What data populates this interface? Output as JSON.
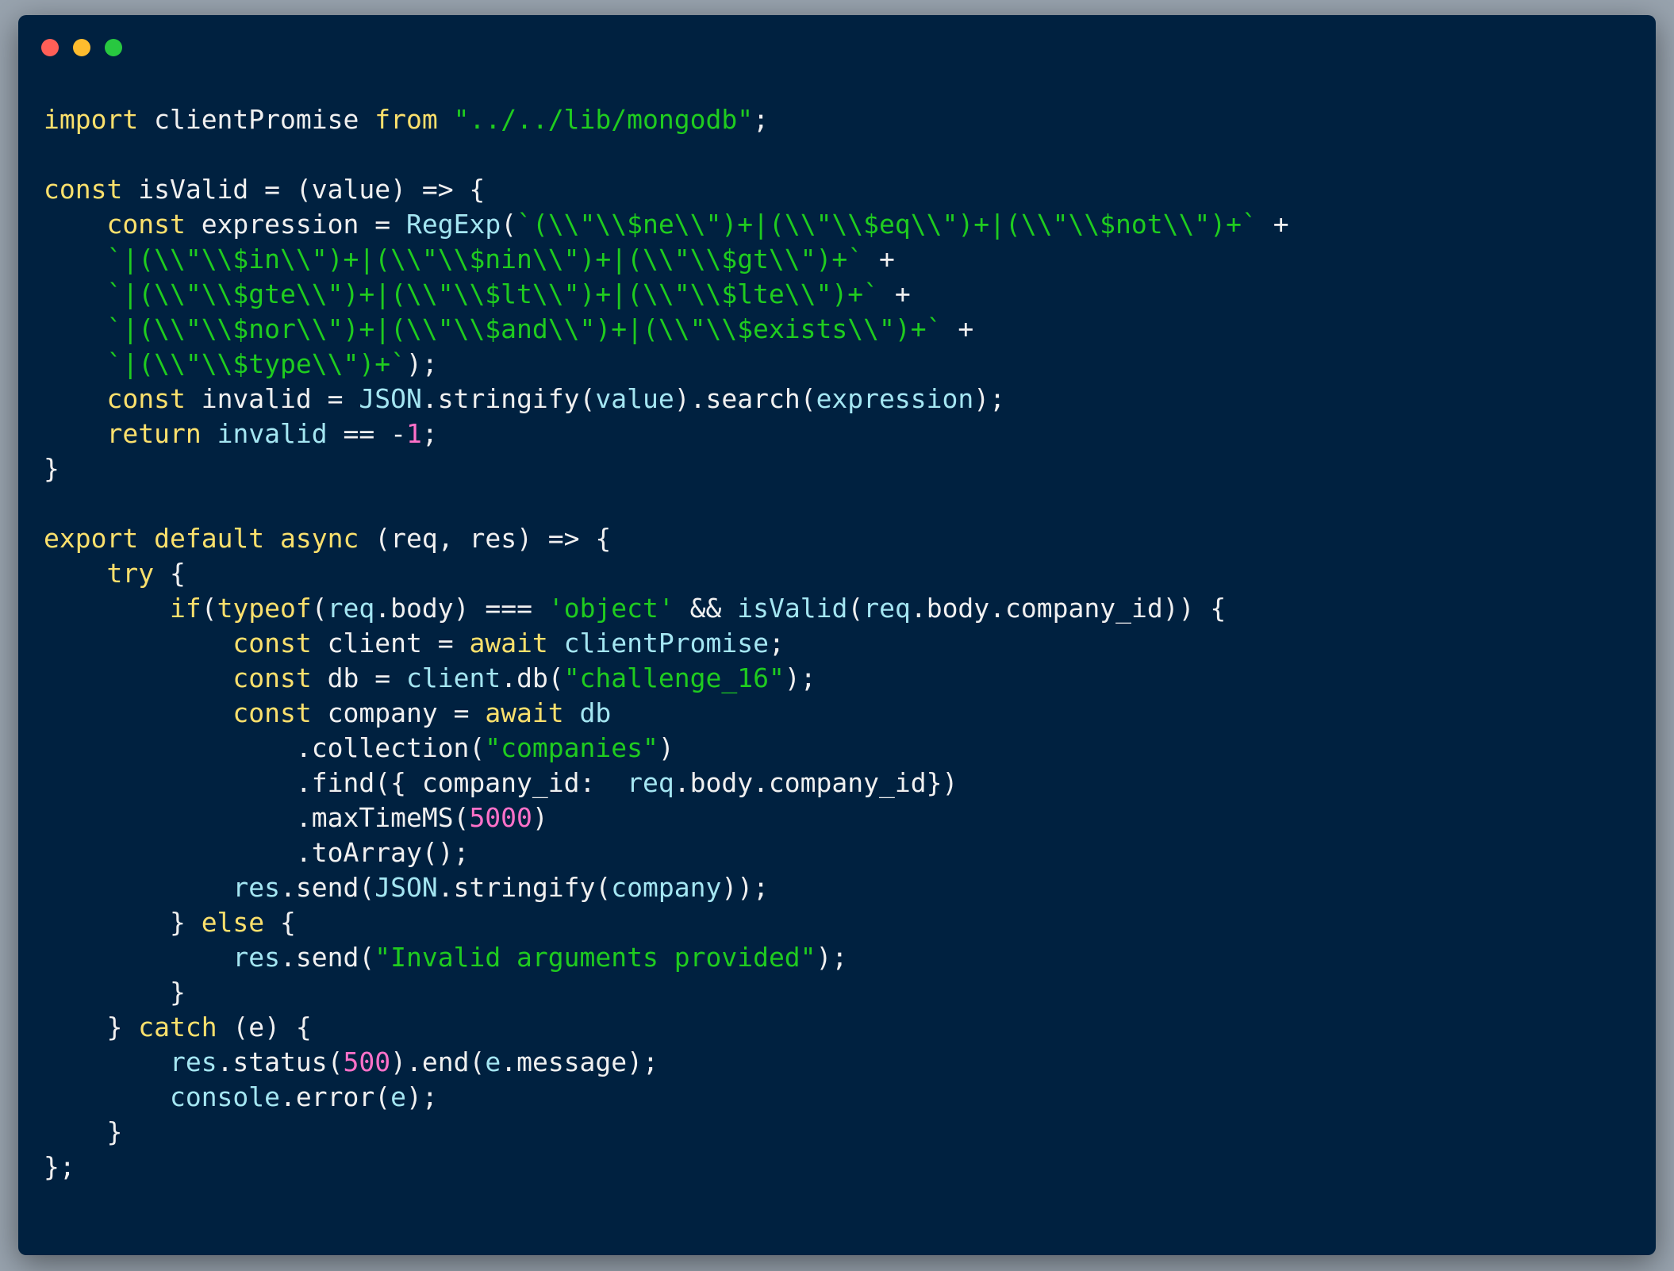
{
  "window": {
    "buttons": [
      {
        "name": "close",
        "color": "#ff5f57"
      },
      {
        "name": "minimize",
        "color": "#febc2e"
      },
      {
        "name": "maximize",
        "color": "#28c840"
      }
    ]
  },
  "colors": {
    "background": "#98a3ae",
    "editor_bg": "#002140",
    "keyword": "#fbe06c",
    "string": "#1fcc1f",
    "number": "#ff71c9",
    "identifier": "#a4e6f2",
    "plain": "#f0f0f0"
  },
  "code": {
    "language": "javascript",
    "lines": [
      [
        [
          "kw",
          "import"
        ],
        [
          "plain",
          " clientPromise "
        ],
        [
          "kw",
          "from"
        ],
        [
          "plain",
          " "
        ],
        [
          "str",
          "\"../../lib/mongodb\""
        ],
        [
          "plain",
          ";"
        ]
      ],
      [],
      [
        [
          "kw",
          "const"
        ],
        [
          "plain",
          " isValid = (value) => {"
        ]
      ],
      [
        [
          "plain",
          "    "
        ],
        [
          "kw",
          "const"
        ],
        [
          "plain",
          " expression = "
        ],
        [
          "id",
          "RegExp"
        ],
        [
          "plain",
          "("
        ],
        [
          "str",
          "`(\\\\\"\\\\$ne\\\\\")+|(\\\\\"\\\\$eq\\\\\")+|(\\\\\"\\\\$not\\\\\")+`"
        ],
        [
          "plain",
          " +"
        ]
      ],
      [
        [
          "plain",
          "    "
        ],
        [
          "str",
          "`|(\\\\\"\\\\$in\\\\\")+|(\\\\\"\\\\$nin\\\\\")+|(\\\\\"\\\\$gt\\\\\")+`"
        ],
        [
          "plain",
          " +"
        ]
      ],
      [
        [
          "plain",
          "    "
        ],
        [
          "str",
          "`|(\\\\\"\\\\$gte\\\\\")+|(\\\\\"\\\\$lt\\\\\")+|(\\\\\"\\\\$lte\\\\\")+`"
        ],
        [
          "plain",
          " +"
        ]
      ],
      [
        [
          "plain",
          "    "
        ],
        [
          "str",
          "`|(\\\\\"\\\\$nor\\\\\")+|(\\\\\"\\\\$and\\\\\")+|(\\\\\"\\\\$exists\\\\\")+`"
        ],
        [
          "plain",
          " +"
        ]
      ],
      [
        [
          "plain",
          "    "
        ],
        [
          "str",
          "`|(\\\\\"\\\\$type\\\\\")+`"
        ],
        [
          "plain",
          ");"
        ]
      ],
      [
        [
          "plain",
          "    "
        ],
        [
          "kw",
          "const"
        ],
        [
          "plain",
          " invalid = "
        ],
        [
          "id",
          "JSON"
        ],
        [
          "plain",
          ".stringify("
        ],
        [
          "id",
          "value"
        ],
        [
          "plain",
          ").search("
        ],
        [
          "id",
          "expression"
        ],
        [
          "plain",
          ");"
        ]
      ],
      [
        [
          "plain",
          "    "
        ],
        [
          "kw",
          "return"
        ],
        [
          "plain",
          " "
        ],
        [
          "id",
          "invalid"
        ],
        [
          "plain",
          " == -"
        ],
        [
          "num",
          "1"
        ],
        [
          "plain",
          ";"
        ]
      ],
      [
        [
          "plain",
          "}"
        ]
      ],
      [],
      [
        [
          "kw",
          "export"
        ],
        [
          "plain",
          " "
        ],
        [
          "kw",
          "default"
        ],
        [
          "plain",
          " "
        ],
        [
          "kw",
          "async"
        ],
        [
          "plain",
          " (req, res) => {"
        ]
      ],
      [
        [
          "plain",
          "    "
        ],
        [
          "kw",
          "try"
        ],
        [
          "plain",
          " {"
        ]
      ],
      [
        [
          "plain",
          "        "
        ],
        [
          "kw",
          "if"
        ],
        [
          "plain",
          "("
        ],
        [
          "kw",
          "typeof"
        ],
        [
          "plain",
          "("
        ],
        [
          "id",
          "req"
        ],
        [
          "plain",
          ".body) === "
        ],
        [
          "str",
          "'object'"
        ],
        [
          "plain",
          " && "
        ],
        [
          "id",
          "isValid"
        ],
        [
          "plain",
          "("
        ],
        [
          "id",
          "req"
        ],
        [
          "plain",
          ".body.company_id)) {"
        ]
      ],
      [
        [
          "plain",
          "            "
        ],
        [
          "kw",
          "const"
        ],
        [
          "plain",
          " client = "
        ],
        [
          "kw",
          "await"
        ],
        [
          "plain",
          " "
        ],
        [
          "id",
          "clientPromise"
        ],
        [
          "plain",
          ";"
        ]
      ],
      [
        [
          "plain",
          "            "
        ],
        [
          "kw",
          "const"
        ],
        [
          "plain",
          " db = "
        ],
        [
          "id",
          "client"
        ],
        [
          "plain",
          ".db("
        ],
        [
          "str",
          "\"challenge_16\""
        ],
        [
          "plain",
          ");"
        ]
      ],
      [
        [
          "plain",
          "            "
        ],
        [
          "kw",
          "const"
        ],
        [
          "plain",
          " company = "
        ],
        [
          "kw",
          "await"
        ],
        [
          "plain",
          " "
        ],
        [
          "id",
          "db"
        ]
      ],
      [
        [
          "plain",
          "                .collection("
        ],
        [
          "str",
          "\"companies\""
        ],
        [
          "plain",
          ")"
        ]
      ],
      [
        [
          "plain",
          "                .find({ company_id:  "
        ],
        [
          "id",
          "req"
        ],
        [
          "plain",
          ".body.company_id})"
        ]
      ],
      [
        [
          "plain",
          "                .maxTimeMS("
        ],
        [
          "num",
          "5000"
        ],
        [
          "plain",
          ")"
        ]
      ],
      [
        [
          "plain",
          "                .toArray();"
        ]
      ],
      [
        [
          "plain",
          "            "
        ],
        [
          "id",
          "res"
        ],
        [
          "plain",
          ".send("
        ],
        [
          "id",
          "JSON"
        ],
        [
          "plain",
          ".stringify("
        ],
        [
          "id",
          "company"
        ],
        [
          "plain",
          "));"
        ]
      ],
      [
        [
          "plain",
          "        } "
        ],
        [
          "kw",
          "else"
        ],
        [
          "plain",
          " {"
        ]
      ],
      [
        [
          "plain",
          "            "
        ],
        [
          "id",
          "res"
        ],
        [
          "plain",
          ".send("
        ],
        [
          "str",
          "\"Invalid arguments provided\""
        ],
        [
          "plain",
          ");"
        ]
      ],
      [
        [
          "plain",
          "        }"
        ]
      ],
      [
        [
          "plain",
          "    } "
        ],
        [
          "kw",
          "catch"
        ],
        [
          "plain",
          " (e) {"
        ]
      ],
      [
        [
          "plain",
          "        "
        ],
        [
          "id",
          "res"
        ],
        [
          "plain",
          ".status("
        ],
        [
          "num",
          "500"
        ],
        [
          "plain",
          ").end("
        ],
        [
          "id",
          "e"
        ],
        [
          "plain",
          ".message);"
        ]
      ],
      [
        [
          "plain",
          "        "
        ],
        [
          "id",
          "console"
        ],
        [
          "plain",
          ".error("
        ],
        [
          "id",
          "e"
        ],
        [
          "plain",
          ");"
        ]
      ],
      [
        [
          "plain",
          "    }"
        ]
      ],
      [
        [
          "plain",
          "};"
        ]
      ]
    ]
  }
}
